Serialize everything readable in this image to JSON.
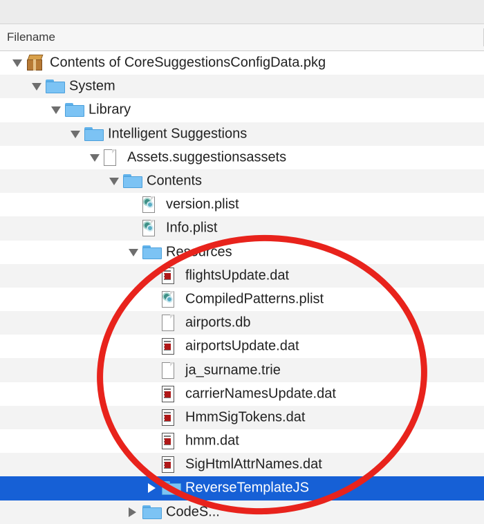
{
  "table": {
    "column_header": "Filename"
  },
  "rows": [
    {
      "depth": 0,
      "disclosure": "down",
      "icon": "package-icon",
      "name": "Contents of CoreSuggestionsConfigData.pkg"
    },
    {
      "depth": 1,
      "disclosure": "down",
      "icon": "folder-icon",
      "name": "System"
    },
    {
      "depth": 2,
      "disclosure": "down",
      "icon": "folder-icon",
      "name": "Library"
    },
    {
      "depth": 3,
      "disclosure": "down",
      "icon": "folder-icon",
      "name": "Intelligent Suggestions"
    },
    {
      "depth": 4,
      "disclosure": "down",
      "icon": "document-icon",
      "name": "Assets.suggestionsassets"
    },
    {
      "depth": 5,
      "disclosure": "down",
      "icon": "folder-icon",
      "name": "Contents"
    },
    {
      "depth": 6,
      "disclosure": "none",
      "icon": "plist-icon",
      "name": "version.plist"
    },
    {
      "depth": 6,
      "disclosure": "none",
      "icon": "plist-icon",
      "name": "Info.plist"
    },
    {
      "depth": 6,
      "disclosure": "down",
      "icon": "folder-icon",
      "name": "Resources"
    },
    {
      "depth": 7,
      "disclosure": "none",
      "icon": "dat-file-icon",
      "name": "flightsUpdate.dat"
    },
    {
      "depth": 7,
      "disclosure": "none",
      "icon": "plist-icon",
      "name": "CompiledPatterns.plist"
    },
    {
      "depth": 7,
      "disclosure": "none",
      "icon": "document-icon",
      "name": "airports.db"
    },
    {
      "depth": 7,
      "disclosure": "none",
      "icon": "dat-file-icon",
      "name": "airportsUpdate.dat"
    },
    {
      "depth": 7,
      "disclosure": "none",
      "icon": "document-icon",
      "name": "ja_surname.trie"
    },
    {
      "depth": 7,
      "disclosure": "none",
      "icon": "dat-file-icon",
      "name": "carrierNamesUpdate.dat"
    },
    {
      "depth": 7,
      "disclosure": "none",
      "icon": "dat-file-icon",
      "name": "HmmSigTokens.dat"
    },
    {
      "depth": 7,
      "disclosure": "none",
      "icon": "dat-file-icon",
      "name": "hmm.dat"
    },
    {
      "depth": 7,
      "disclosure": "none",
      "icon": "dat-file-icon",
      "name": "SigHtmlAttrNames.dat"
    },
    {
      "depth": 7,
      "disclosure": "right",
      "icon": "folder-icon",
      "name": "ReverseTemplateJS",
      "selected": true
    },
    {
      "depth": 6,
      "disclosure": "right",
      "icon": "folder-icon",
      "name": "CodeS..."
    }
  ],
  "colors": {
    "selection": "#1660d6",
    "annotation_circle": "#e8231c",
    "folder": "#7cc3f4"
  }
}
